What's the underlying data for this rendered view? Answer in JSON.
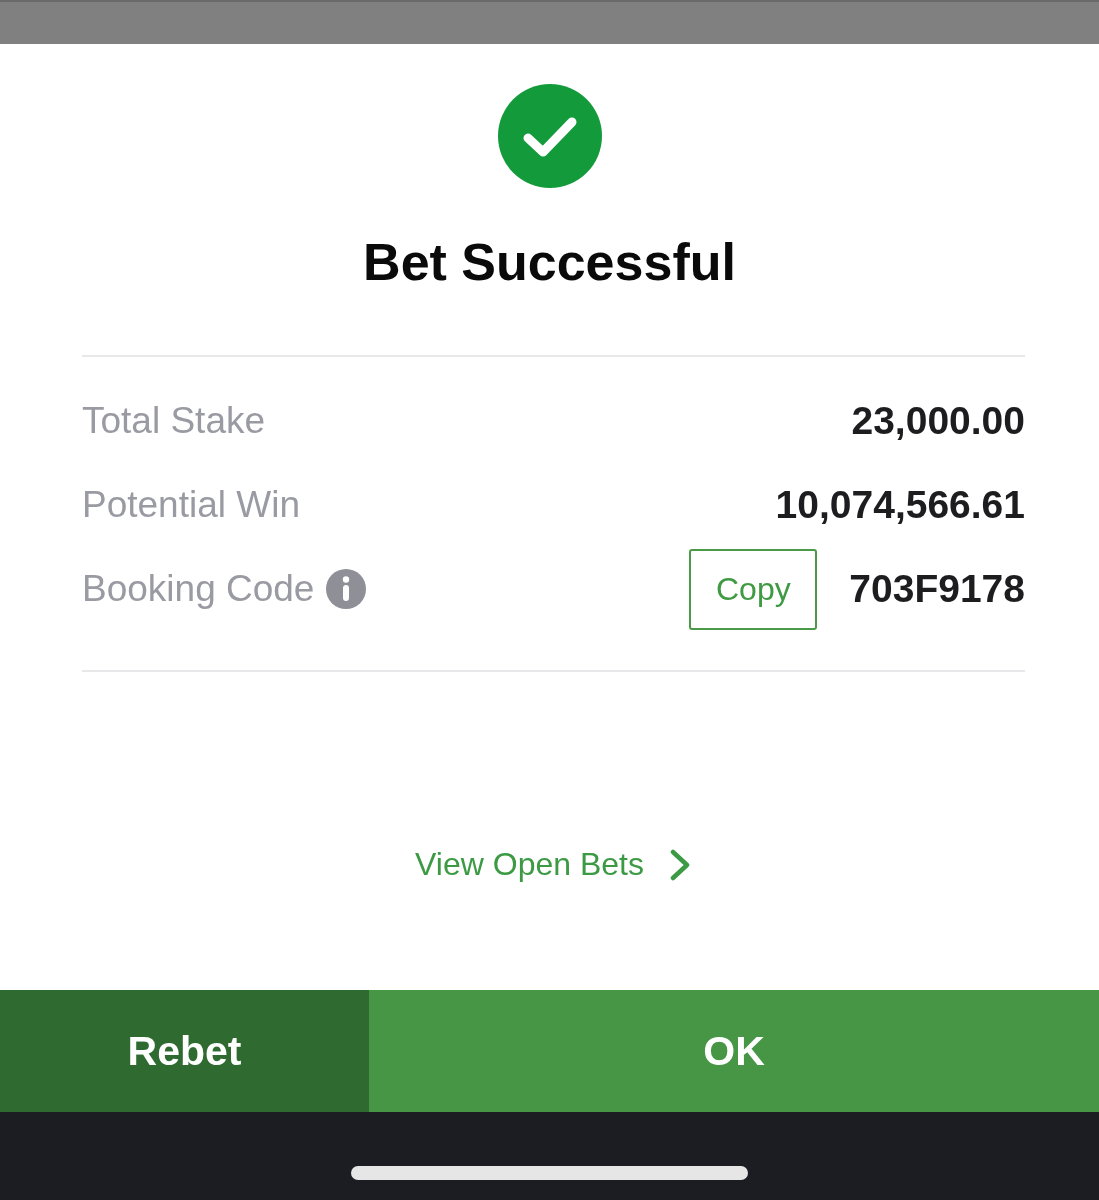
{
  "result": {
    "title": "Bet Successful"
  },
  "summary": {
    "rows": [
      {
        "kind": "amount",
        "label": "Total Stake",
        "value": "23,000.00"
      },
      {
        "kind": "amount",
        "label": "Potential Win",
        "value": "10,074,566.61"
      },
      {
        "kind": "code",
        "label": "Booking Code",
        "info": true,
        "copy_button": "Copy",
        "value": "703F9178"
      }
    ]
  },
  "link": {
    "label": "View Open Bets"
  },
  "buttons": [
    {
      "kind": "secondary",
      "label": "Rebet"
    },
    {
      "kind": "primary",
      "label": "OK"
    }
  ]
}
